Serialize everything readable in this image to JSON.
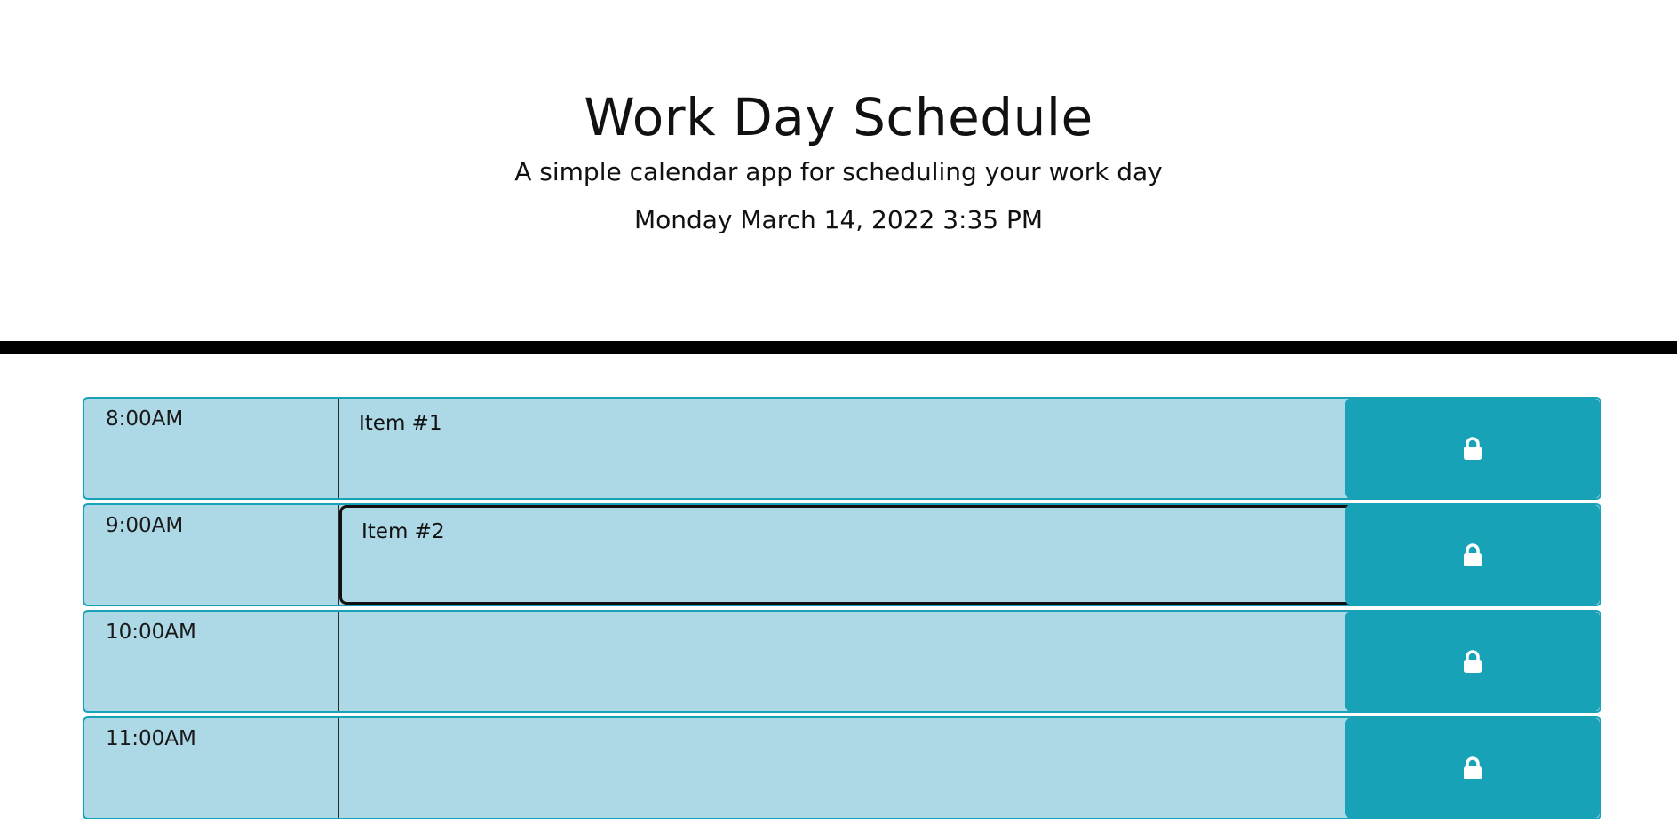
{
  "header": {
    "title": "Work Day Schedule",
    "subtitle": "A simple calendar app for scheduling your work day",
    "current_day": "Monday March 14, 2022 3:35 PM"
  },
  "colors": {
    "past_block": "#add8e6",
    "save_button": "#17a2b8",
    "divider": "#000000"
  },
  "schedule": [
    {
      "hour": "8:00AM",
      "description": "Item #1",
      "save_icon": "lock-icon"
    },
    {
      "hour": "9:00AM",
      "description": "Item #2",
      "save_icon": "lock-icon",
      "focused": true
    },
    {
      "hour": "10:00AM",
      "description": "",
      "save_icon": "lock-icon"
    },
    {
      "hour": "11:00AM",
      "description": "",
      "save_icon": "lock-icon"
    }
  ]
}
